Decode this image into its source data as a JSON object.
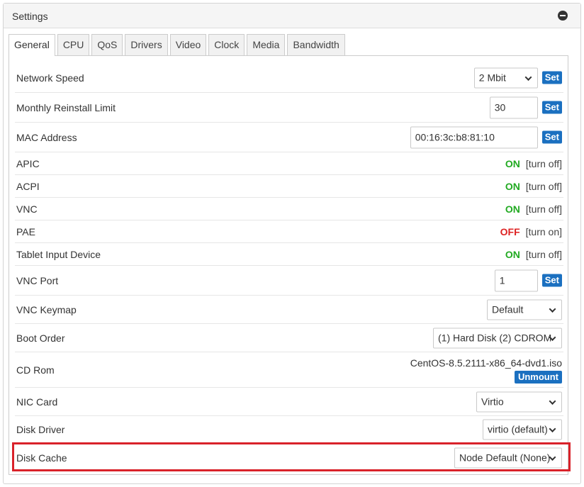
{
  "panel": {
    "title": "Settings",
    "collapse_icon": "minus-circle-icon"
  },
  "tabs": [
    {
      "label": "General",
      "active": true
    },
    {
      "label": "CPU"
    },
    {
      "label": "QoS"
    },
    {
      "label": "Drivers"
    },
    {
      "label": "Video"
    },
    {
      "label": "Clock"
    },
    {
      "label": "Media"
    },
    {
      "label": "Bandwidth"
    }
  ],
  "buttons": {
    "set": "Set",
    "unmount": "Unmount"
  },
  "settings": {
    "network_speed": {
      "label": "Network Speed",
      "value": "2 Mbit"
    },
    "reinstall_limit": {
      "label": "Monthly Reinstall Limit",
      "value": "30"
    },
    "mac_address": {
      "label": "MAC Address",
      "value": "00:16:3c:b8:81:10"
    },
    "apic": {
      "label": "APIC",
      "state": "ON",
      "action": "[turn off]"
    },
    "acpi": {
      "label": "ACPI",
      "state": "ON",
      "action": "[turn off]"
    },
    "vnc": {
      "label": "VNC",
      "state": "ON",
      "action": "[turn off]"
    },
    "pae": {
      "label": "PAE",
      "state": "OFF",
      "action": "[turn on]"
    },
    "tablet": {
      "label": "Tablet Input Device",
      "state": "ON",
      "action": "[turn off]"
    },
    "vnc_port": {
      "label": "VNC Port",
      "value": "1"
    },
    "vnc_keymap": {
      "label": "VNC Keymap",
      "value": "Default"
    },
    "boot_order": {
      "label": "Boot Order",
      "value": "(1) Hard Disk (2) CDROM"
    },
    "cd_rom": {
      "label": "CD Rom",
      "value": "CentOS-8.5.2111-x86_64-dvd1.iso"
    },
    "nic_card": {
      "label": "NIC Card",
      "value": "Virtio"
    },
    "disk_driver": {
      "label": "Disk Driver",
      "value": "virtio (default)"
    },
    "disk_cache": {
      "label": "Disk Cache",
      "value": "Node Default (None)"
    }
  },
  "colors": {
    "on": "#22aa22",
    "off": "#dd2222",
    "button": "#1b70c0",
    "highlight": "#d9222a"
  }
}
